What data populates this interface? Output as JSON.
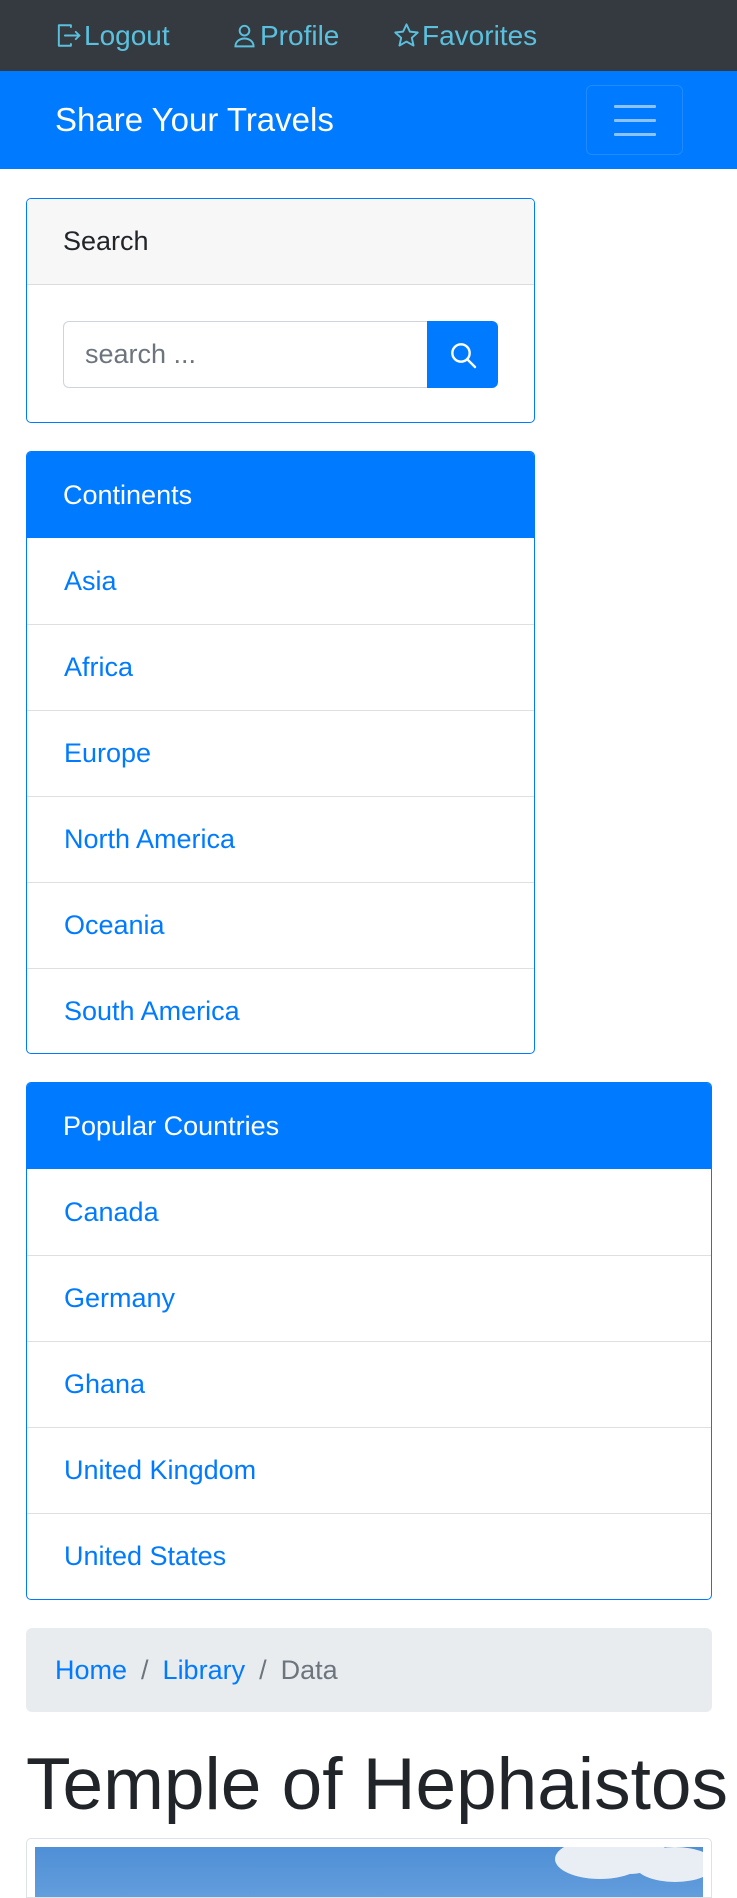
{
  "topbar": {
    "logout_label": "Logout",
    "profile_label": "Profile",
    "favorites_label": "Favorites",
    "link_color": "#5bc0de",
    "background": "#343a40"
  },
  "navbar": {
    "brand": "Share Your Travels",
    "background": "#007bff"
  },
  "search": {
    "header": "Search",
    "placeholder": "search ..."
  },
  "continents": {
    "header": "Continents",
    "items": [
      "Asia",
      "Africa",
      "Europe",
      "North America",
      "Oceania",
      "South America"
    ]
  },
  "popular_countries": {
    "header": "Popular Countries",
    "items": [
      "Canada",
      "Germany",
      "Ghana",
      "United Kingdom",
      "United States"
    ]
  },
  "breadcrumb": {
    "items": [
      "Home",
      "Library"
    ],
    "active": "Data"
  },
  "page": {
    "title": "Temple of Hephaistos"
  },
  "colors": {
    "primary": "#007bff",
    "breadcrumb_bg": "#e9ecef"
  }
}
